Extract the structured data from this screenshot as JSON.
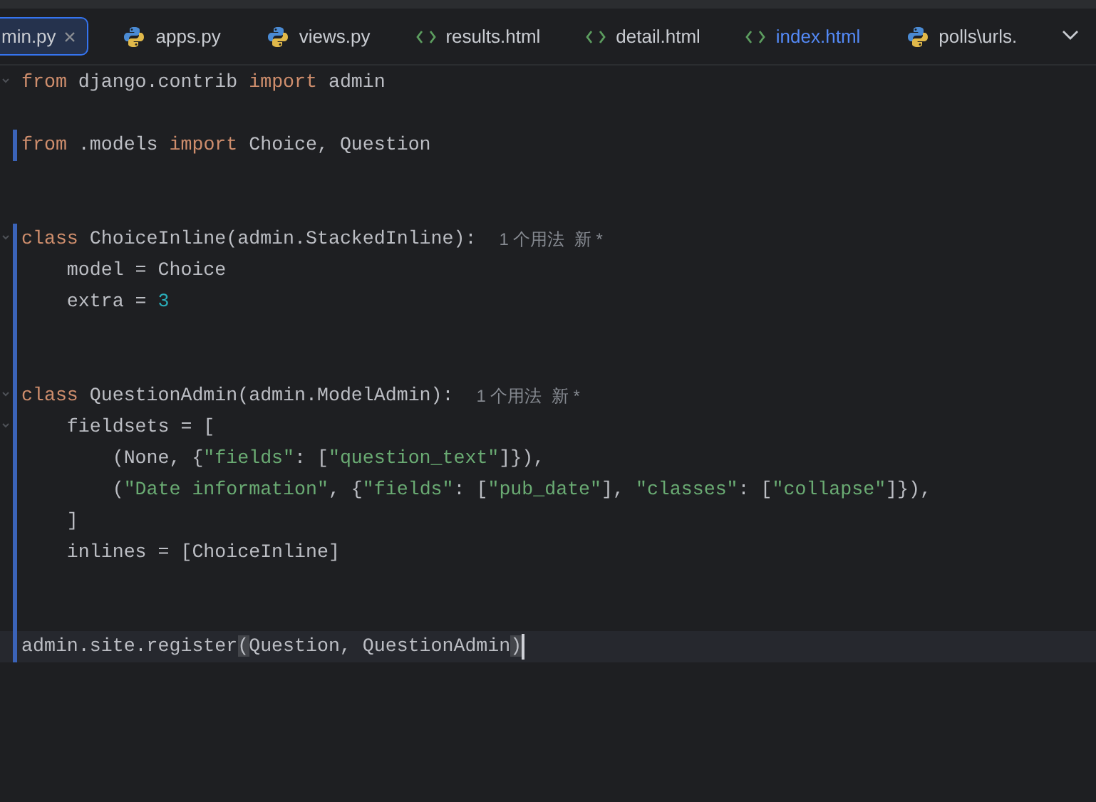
{
  "tabs": [
    {
      "label": "min.py",
      "kind": "python",
      "selected": true,
      "modified": false,
      "closable": true
    },
    {
      "label": "apps.py",
      "kind": "python",
      "selected": false,
      "modified": false,
      "closable": false
    },
    {
      "label": "views.py",
      "kind": "python",
      "selected": false,
      "modified": false,
      "closable": false
    },
    {
      "label": "results.html",
      "kind": "html",
      "selected": false,
      "modified": false,
      "closable": false
    },
    {
      "label": "detail.html",
      "kind": "html",
      "selected": false,
      "modified": false,
      "closable": false
    },
    {
      "label": "index.html",
      "kind": "html",
      "selected": false,
      "modified": true,
      "closable": false
    },
    {
      "label": "polls\\urls.",
      "kind": "python",
      "selected": false,
      "modified": false,
      "closable": false
    }
  ],
  "editor": {
    "lines": [
      {
        "changed": false,
        "foldable": true,
        "current": false,
        "segments": [
          {
            "kind": "keyword",
            "text": "from "
          },
          {
            "kind": "plain",
            "text": "django.contrib "
          },
          {
            "kind": "keyword",
            "text": "import "
          },
          {
            "kind": "plain",
            "text": "admin"
          }
        ]
      },
      {
        "changed": false,
        "foldable": false,
        "current": false
      },
      {
        "changed": true,
        "foldable": false,
        "current": false,
        "segments": [
          {
            "kind": "keyword",
            "text": "from "
          },
          {
            "kind": "plain",
            "text": ".models "
          },
          {
            "kind": "keyword",
            "text": "import "
          },
          {
            "kind": "plain",
            "text": "Choice, Question"
          }
        ]
      },
      {
        "changed": false,
        "foldable": false,
        "current": false
      },
      {
        "changed": false,
        "foldable": false,
        "current": false
      },
      {
        "changed": true,
        "foldable": true,
        "current": false,
        "hint": "1 个用法  新 *",
        "segments": [
          {
            "kind": "keyword",
            "text": "class "
          },
          {
            "kind": "plain",
            "text": "ChoiceInline(admin.StackedInline):"
          }
        ]
      },
      {
        "changed": true,
        "foldable": false,
        "current": false,
        "segments": [
          {
            "kind": "plain",
            "text": "    model = Choice"
          }
        ]
      },
      {
        "changed": true,
        "foldable": false,
        "current": false,
        "segments": [
          {
            "kind": "plain",
            "text": "    extra = "
          },
          {
            "kind": "number",
            "text": "3"
          }
        ]
      },
      {
        "changed": true,
        "foldable": false,
        "current": false
      },
      {
        "changed": true,
        "foldable": false,
        "current": false
      },
      {
        "changed": true,
        "foldable": true,
        "current": false,
        "hint": "1 个用法  新 *",
        "segments": [
          {
            "kind": "keyword",
            "text": "class "
          },
          {
            "kind": "plain",
            "text": "QuestionAdmin(admin.ModelAdmin):"
          }
        ]
      },
      {
        "changed": true,
        "foldable": true,
        "current": false,
        "segments": [
          {
            "kind": "plain",
            "text": "    fieldsets = ["
          }
        ]
      },
      {
        "changed": true,
        "foldable": false,
        "current": false,
        "segments": [
          {
            "kind": "plain",
            "text": "        (None, {"
          },
          {
            "kind": "string",
            "text": "\"fields\""
          },
          {
            "kind": "plain",
            "text": ": ["
          },
          {
            "kind": "string",
            "text": "\"question_text\""
          },
          {
            "kind": "plain",
            "text": "]}),"
          }
        ]
      },
      {
        "changed": true,
        "foldable": false,
        "current": false,
        "segments": [
          {
            "kind": "plain",
            "text": "        ("
          },
          {
            "kind": "string",
            "text": "\"Date information\""
          },
          {
            "kind": "plain",
            "text": ", {"
          },
          {
            "kind": "string",
            "text": "\"fields\""
          },
          {
            "kind": "plain",
            "text": ": ["
          },
          {
            "kind": "string",
            "text": "\"pub_date\""
          },
          {
            "kind": "plain",
            "text": "], "
          },
          {
            "kind": "string",
            "text": "\"classes\""
          },
          {
            "kind": "plain",
            "text": ": ["
          },
          {
            "kind": "string",
            "text": "\"collapse\""
          },
          {
            "kind": "plain",
            "text": "]}),"
          }
        ]
      },
      {
        "changed": true,
        "foldable": false,
        "current": false,
        "segments": [
          {
            "kind": "plain",
            "text": "    ]"
          }
        ]
      },
      {
        "changed": true,
        "foldable": false,
        "current": false,
        "segments": [
          {
            "kind": "plain",
            "text": "    inlines = [ChoiceInline]"
          }
        ]
      },
      {
        "changed": true,
        "foldable": false,
        "current": false
      },
      {
        "changed": true,
        "foldable": false,
        "current": false
      },
      {
        "changed": true,
        "foldable": false,
        "current": true,
        "segments": [
          {
            "kind": "plain",
            "text": "admin.site.register"
          },
          {
            "kind": "bracket",
            "text": "("
          },
          {
            "kind": "plain",
            "text": "Question, QuestionAdmin"
          },
          {
            "kind": "bracket",
            "text": ")"
          }
        ]
      }
    ]
  }
}
